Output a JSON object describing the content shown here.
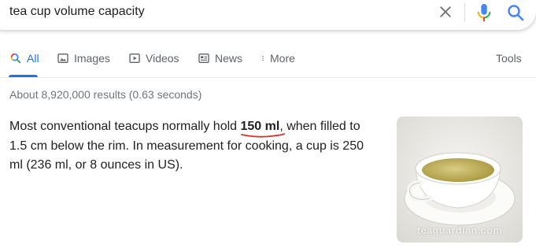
{
  "search": {
    "query": "tea cup volume capacity"
  },
  "tabs": [
    {
      "label": "All",
      "icon": "search-icon",
      "active": true
    },
    {
      "label": "Images",
      "icon": "image-icon"
    },
    {
      "label": "Videos",
      "icon": "video-icon"
    },
    {
      "label": "News",
      "icon": "news-icon"
    },
    {
      "label": "More",
      "icon": "more-dots-icon"
    }
  ],
  "tools_label": "Tools",
  "result_stats": "About 8,920,000 results (0.63 seconds)",
  "snippet": {
    "before": "Most conventional teacups normally hold ",
    "highlight": "150 ml",
    "after": ", when filled to 1.5 cm below the rim. In measurement for cooking, a cup is 250 ml (236 ml, or 8 ounces in US)."
  },
  "thumbnail": {
    "watermark": "teaguardian.com"
  },
  "colors": {
    "accent": "#1a73e8",
    "underline_mark": "#d93025"
  }
}
